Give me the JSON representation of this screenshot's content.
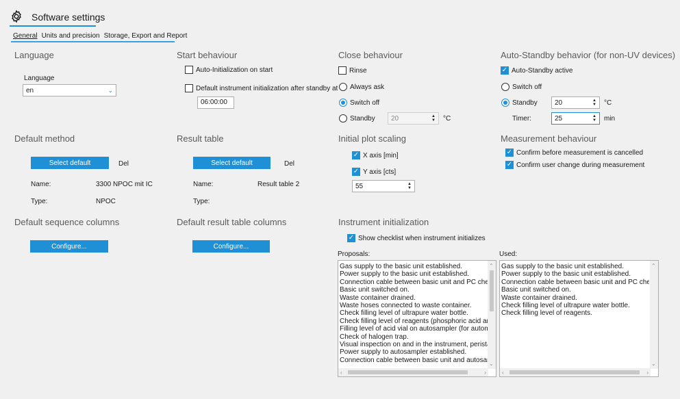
{
  "window": {
    "title": "Software settings"
  },
  "tabs": [
    {
      "label": "General",
      "active": true
    },
    {
      "label": "Units and precision",
      "active": false
    },
    {
      "label": "Storage, Export and Report",
      "active": false
    }
  ],
  "language": {
    "section_title": "Language",
    "field_label": "Language",
    "selected": "en"
  },
  "start_behaviour": {
    "section_title": "Start behaviour",
    "auto_init_label": "Auto-Initialization on start",
    "auto_init_checked": false,
    "default_init_label": "Default instrument initialization after standby at",
    "default_init_checked": false,
    "time_value": "06:00:00"
  },
  "close_behaviour": {
    "section_title": "Close behaviour",
    "rinse_label": "Rinse",
    "rinse_checked": false,
    "always_ask_label": "Always ask",
    "switch_off_label": "Switch off",
    "standby_label": "Standby",
    "selected": "Switch off",
    "standby_value": "20",
    "unit": "°C"
  },
  "auto_standby": {
    "section_title": "Auto-Standby behavior (for non-UV devices)",
    "active_label": "Auto-Standby active",
    "active_checked": true,
    "switch_off_label": "Switch off",
    "standby_label": "Standby",
    "selected": "Standby",
    "standby_value": "20",
    "standby_unit": "°C",
    "timer_label": "Timer:",
    "timer_value": "25",
    "timer_unit": "min"
  },
  "default_method": {
    "section_title": "Default method",
    "select_button": "Select default",
    "del_button": "Del",
    "name_label": "Name:",
    "name_value": "3300 NPOC mit IC",
    "type_label": "Type:",
    "type_value": "NPOC"
  },
  "result_table": {
    "section_title": "Result table",
    "select_button": "Select default",
    "del_button": "Del",
    "name_label": "Name:",
    "name_value": "Result table 2",
    "type_label": "Type:",
    "type_value": ""
  },
  "initial_plot_scaling": {
    "section_title": "Initial plot scaling",
    "x_axis_label": "X axis [min]",
    "x_axis_checked": true,
    "y_axis_label": "Y axis [cts]",
    "y_axis_checked": true,
    "y_value": "55"
  },
  "measurement_behaviour": {
    "section_title": "Measurement behaviour",
    "confirm_cancel_label": "Confirm before measurement is cancelled",
    "confirm_cancel_checked": true,
    "confirm_user_label": "Confirm user change during measurement",
    "confirm_user_checked": true
  },
  "default_sequence_columns": {
    "section_title": "Default sequence columns",
    "configure_button": "Configure..."
  },
  "default_result_table_columns": {
    "section_title": "Default result table columns",
    "configure_button": "Configure..."
  },
  "instrument_initialization": {
    "section_title": "Instrument initialization",
    "show_checklist_label": "Show checklist when instrument initializes",
    "show_checklist_checked": true,
    "proposals_label": "Proposals:",
    "used_label": "Used:",
    "proposals": [
      "Gas supply to the basic unit established.",
      "Power supply to the basic unit established.",
      "Connection cable between basic unit and PC checked",
      "Basic unit switched on.",
      "Waste container drained.",
      "Waste hoses connected to waste container.",
      "Check filling level of ultrapure water bottle.",
      "Check filling level of reagents (phosphoric acid and/o",
      "Filling level of acid vial on autosampler (for automatic",
      "Check of halogen trap.",
      "Visual inspection on and in the instrument, peristaltic",
      "Power supply to autosampler established.",
      "Connection cable between basic unit and autosample"
    ],
    "used": [
      "Gas supply to the basic unit established.",
      "Power supply to the basic unit established.",
      "Connection cable between basic unit and PC checked",
      "Basic unit switched on.",
      "Waste container drained.",
      "Check filling level of ultrapure water bottle.",
      "Check filling level of reagents."
    ]
  },
  "icons": {
    "settings": "gear-icon",
    "dropdown": "chevron-down-icon",
    "check": "check-icon"
  },
  "colors": {
    "accent": "#1f8fd6",
    "background": "#f0f0f0"
  }
}
